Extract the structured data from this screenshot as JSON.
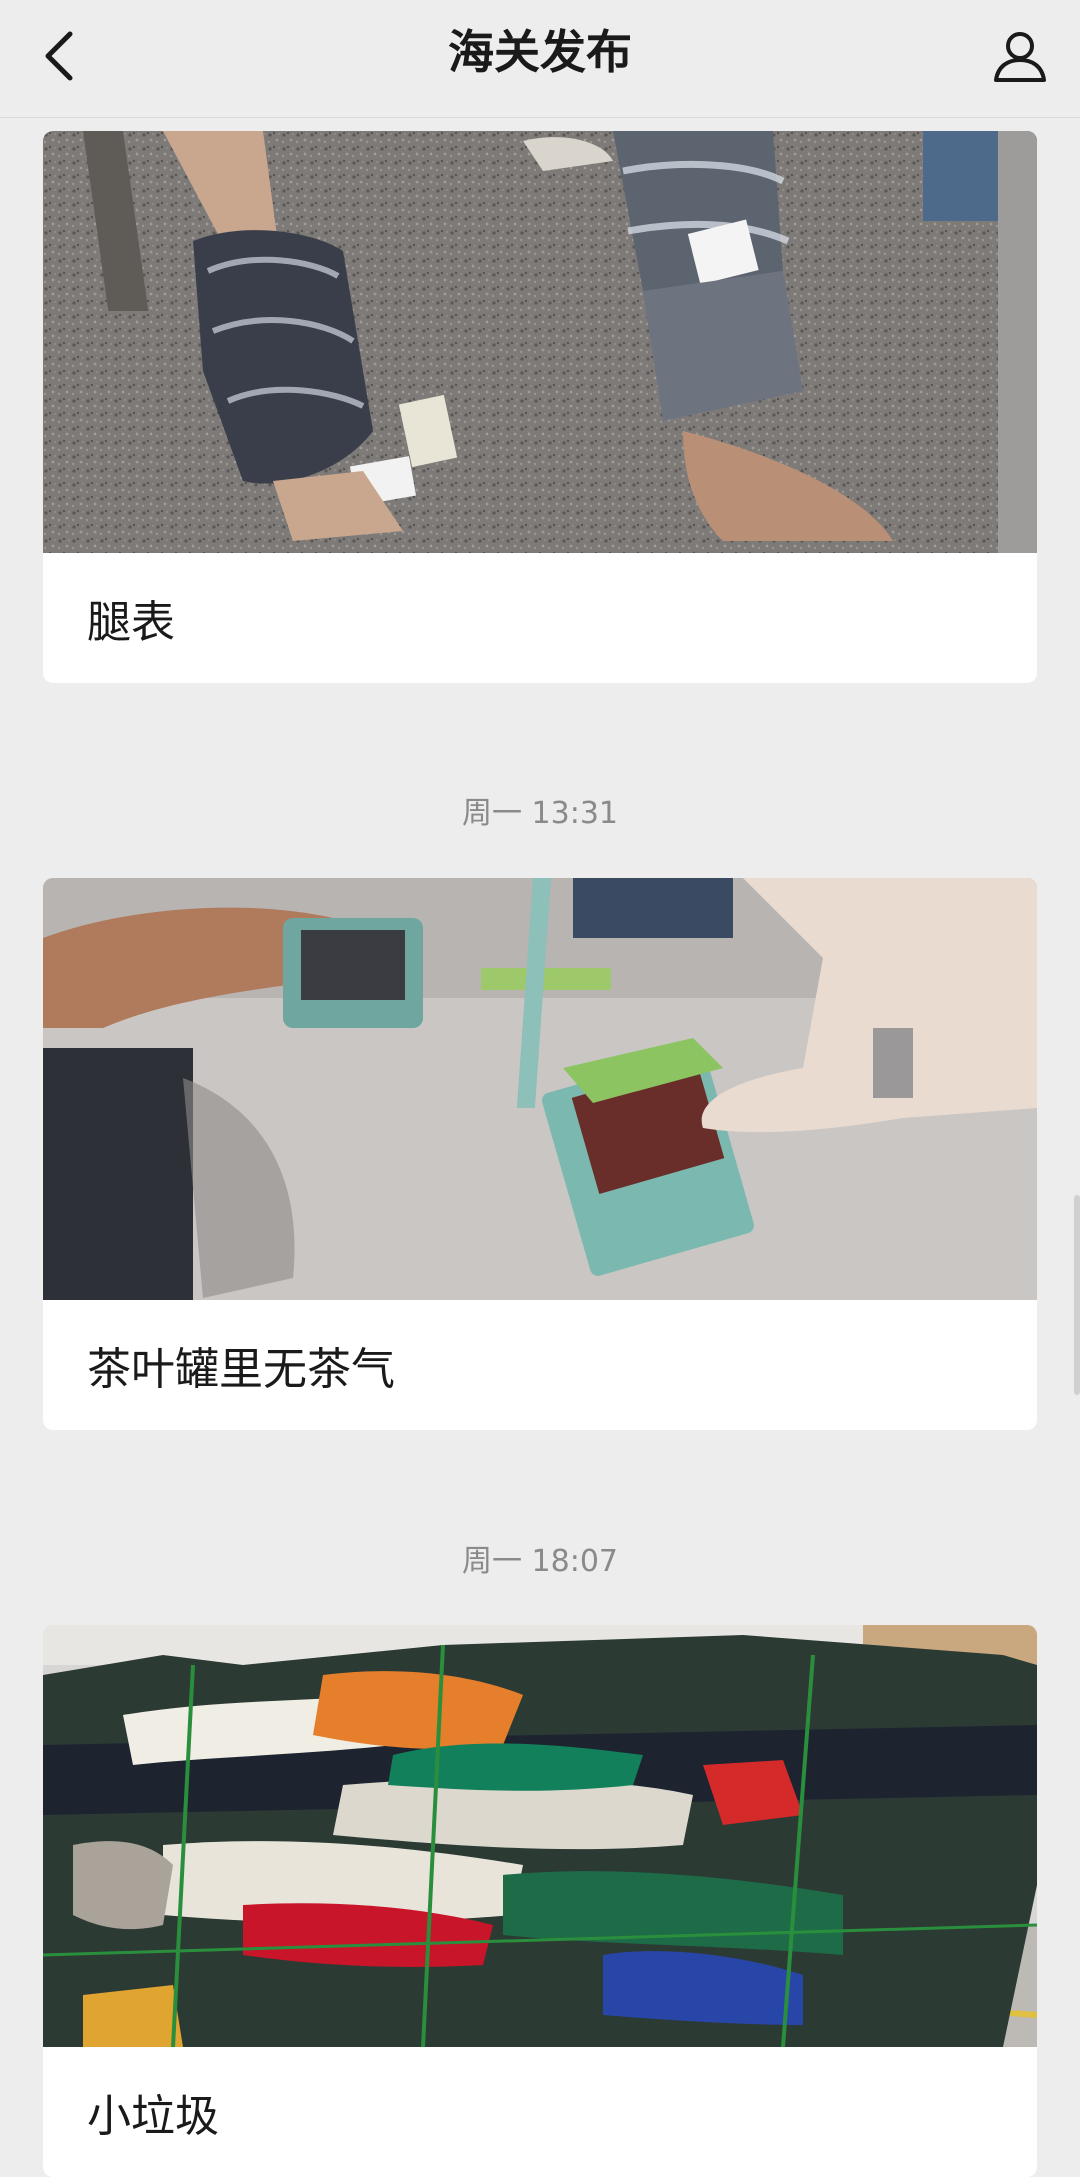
{
  "nav": {
    "title": "海关发布",
    "back_icon": "chevron-left-icon",
    "profile_icon": "person-icon"
  },
  "feed": {
    "cards": [
      {
        "title": "腿表",
        "image": "legs wrapped with watches in plastic film"
      },
      {
        "title": "茶叶罐里无茶气",
        "image": "hand pointing at opened tea tin"
      },
      {
        "title": "小垃圾",
        "image": "bales of used clothing"
      }
    ],
    "timestamps": [
      "周一 13:31",
      "周一 18:07"
    ]
  },
  "colors": {
    "background": "#ededed",
    "card": "#ffffff",
    "timestamp_text": "#8a8a8a",
    "title_text": "#1a1a1a"
  }
}
